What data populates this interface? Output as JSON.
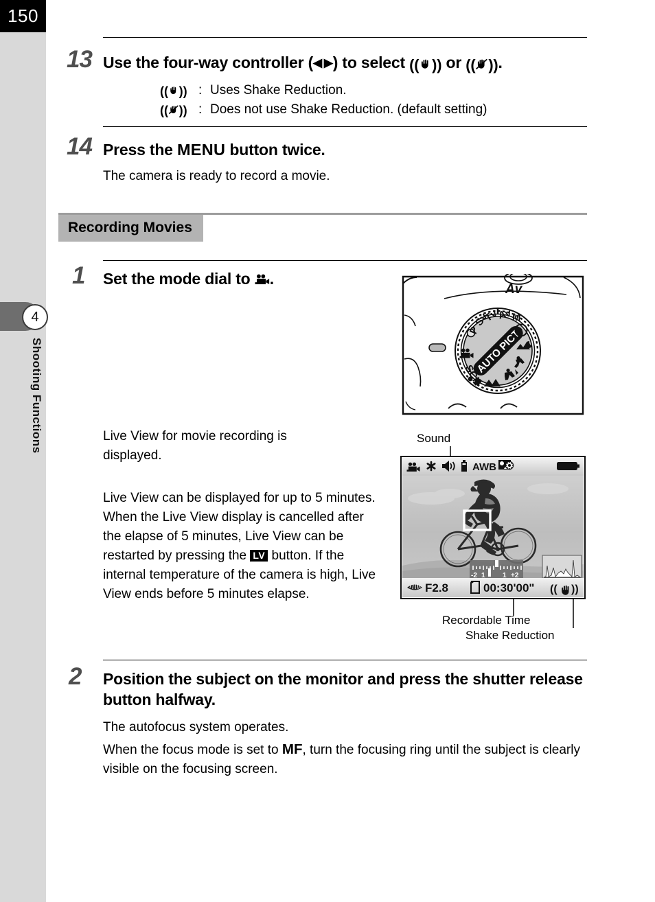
{
  "page": {
    "number": "150",
    "chapter_badge": "4",
    "chapter_label": "Shooting Functions"
  },
  "steps": [
    {
      "number": "13",
      "title_parts": [
        "Use the four-way controller (",
        "◀",
        "▶",
        ") to select ",
        "((SR))",
        " or ",
        "((SR-off))",
        "."
      ],
      "title_text": "Use the four-way controller (◀ ▶) to select ((✋)) or ((✋))."
    },
    {
      "number": "14",
      "title_prefix": "Press the ",
      "title_menu": "MENU",
      "title_suffix": " button twice.",
      "body": "The camera is ready to record a movie."
    },
    {
      "number": "1",
      "title_prefix": "Set the mode dial to ",
      "title_suffix": ".",
      "body_1": "Live View for movie recording is displayed.",
      "body_2_a": "Live View can be displayed for up to 5 minutes. When the Live View display is cancelled after the elapse of 5 minutes, Live View can be restarted by pressing the ",
      "body_2_lv": "LV",
      "body_2_b": " button. If the internal temperature of the camera is high, Live View ends before 5 minutes elapse."
    },
    {
      "number": "2",
      "title": "Position the subject on the monitor and press the shutter release button halfway.",
      "body_1": "The autofocus system operates.",
      "body_2_a": "When the focus mode is set to ",
      "body_2_mf": "MF",
      "body_2_b": ", turn the focusing ring until the subject is clearly visible on the focusing screen."
    }
  ],
  "shake_reduction_legend": [
    {
      "icon": "shake-reduction-on-icon",
      "separator": ":",
      "text": "Uses Shake Reduction."
    },
    {
      "icon": "shake-reduction-off-icon",
      "separator": ":",
      "text": "Does not use Shake Reduction. (default setting)"
    }
  ],
  "section": {
    "title": "Recording Movies"
  },
  "mode_dial": {
    "top_label": "Av",
    "center_label_1": "AUTO",
    "center_label_2": "PICT",
    "positions": [
      "P",
      "Sv",
      "Tv",
      "Av",
      "M",
      "SCN"
    ],
    "movie_position": "movie-mode-icon"
  },
  "lcd": {
    "top_icons": [
      "movie-mode-icon",
      "ae-lock-icon",
      "sound-icon",
      "card-icon",
      "awb-icon",
      "custom-image-icon",
      "battery-icon"
    ],
    "awb_label": "AWB",
    "aperture": "F2.8",
    "recordable_time": "00:30'00\"",
    "shake_reduction_icon": "shake-reduction-on-icon",
    "aperture_icon": "aperture-icon",
    "card_icon": "card-icon",
    "ev_scale_labels": [
      "-2",
      "1",
      "1",
      "+2"
    ],
    "histogram": "histogram-icon",
    "af_frame": "af-frame"
  },
  "callouts": {
    "sound": "Sound",
    "recordable_time": "Recordable Time",
    "shake_reduction": "Shake Reduction"
  },
  "colors": {
    "sidebar": "#d9d9d9",
    "page_number_block": "#000000",
    "chapter_tab": "#6e6e6e",
    "section_chip": "#b3b3b3",
    "section_rule": "#9d9d9d",
    "step_number": "#4f4f4f"
  }
}
